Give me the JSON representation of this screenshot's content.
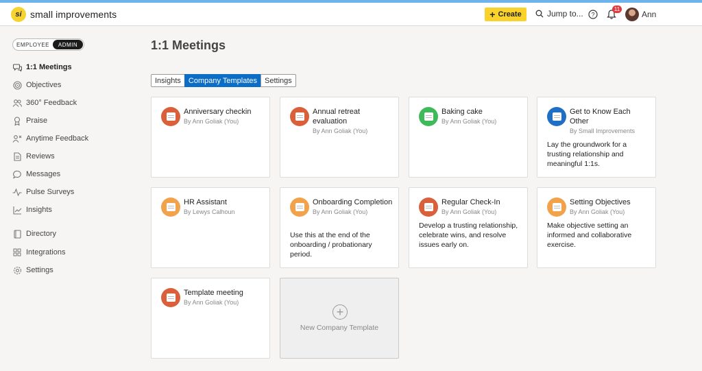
{
  "app": {
    "logo_mark": "si",
    "name": "small improvements"
  },
  "topbar": {
    "create_label": "Create",
    "jump_label": "Jump to...",
    "notification_count": "11",
    "user_name": "Ann"
  },
  "role_toggle": {
    "employee_label": "EMPLOYEE",
    "admin_label": "ADMIN",
    "selected": "ADMIN"
  },
  "sidebar": {
    "items": [
      {
        "label": "1:1 Meetings",
        "icon": "chat-bubbles-icon",
        "active": true
      },
      {
        "label": "Objectives",
        "icon": "target-icon",
        "active": false
      },
      {
        "label": "360° Feedback",
        "icon": "people-icon",
        "active": false
      },
      {
        "label": "Praise",
        "icon": "award-icon",
        "active": false
      },
      {
        "label": "Anytime Feedback",
        "icon": "feedback-person-icon",
        "active": false
      },
      {
        "label": "Reviews",
        "icon": "document-icon",
        "active": false
      },
      {
        "label": "Messages",
        "icon": "message-icon",
        "active": false
      },
      {
        "label": "Pulse Surveys",
        "icon": "pulse-icon",
        "active": false
      },
      {
        "label": "Insights",
        "icon": "chart-icon",
        "active": false
      },
      {
        "label": "Directory",
        "icon": "book-icon",
        "active": false
      },
      {
        "label": "Integrations",
        "icon": "grid-icon",
        "active": false
      },
      {
        "label": "Settings",
        "icon": "gear-icon",
        "active": false
      }
    ]
  },
  "main": {
    "title": "1:1 Meetings",
    "tabs": [
      {
        "label": "Insights",
        "active": false
      },
      {
        "label": "Company Templates",
        "active": true
      },
      {
        "label": "Settings",
        "active": false
      }
    ],
    "templates": [
      {
        "title": "Anniversary checkin",
        "author": "By Ann Goliak (You)",
        "description": "",
        "icon_color": "#d9603b"
      },
      {
        "title": "Annual retreat evaluation",
        "author": "By Ann Goliak (You)",
        "description": "",
        "icon_color": "#d9603b"
      },
      {
        "title": "Baking cake",
        "author": "By Ann Goliak (You)",
        "description": "",
        "icon_color": "#3fba5b"
      },
      {
        "title": "Get to Know Each Other",
        "author": "By Small Improvements",
        "description": "Lay the groundwork for a trusting relationship and meaningful 1:1s.",
        "icon_color": "#1f6fc4"
      },
      {
        "title": "HR Assistant",
        "author": "By Lewys Calhoun",
        "description": "",
        "icon_color": "#f2a24a"
      },
      {
        "title": "Onboarding Completion",
        "author": "By Ann Goliak (You)",
        "description": "Use this at the end of the onboarding / probationary period.",
        "icon_color": "#f2a24a"
      },
      {
        "title": "Regular Check-In",
        "author": "By Ann Goliak (You)",
        "description": "Develop a trusting relationship, celebrate wins, and resolve issues early on.",
        "icon_color": "#d9603b"
      },
      {
        "title": "Setting Objectives",
        "author": "By Ann Goliak (You)",
        "description": "Make objective setting an informed and collaborative exercise.",
        "icon_color": "#f2a24a"
      },
      {
        "title": "Template meeting",
        "author": "By Ann Goliak (You)",
        "description": "",
        "icon_color": "#d9603b"
      }
    ],
    "new_template_label": "New Company Template"
  }
}
